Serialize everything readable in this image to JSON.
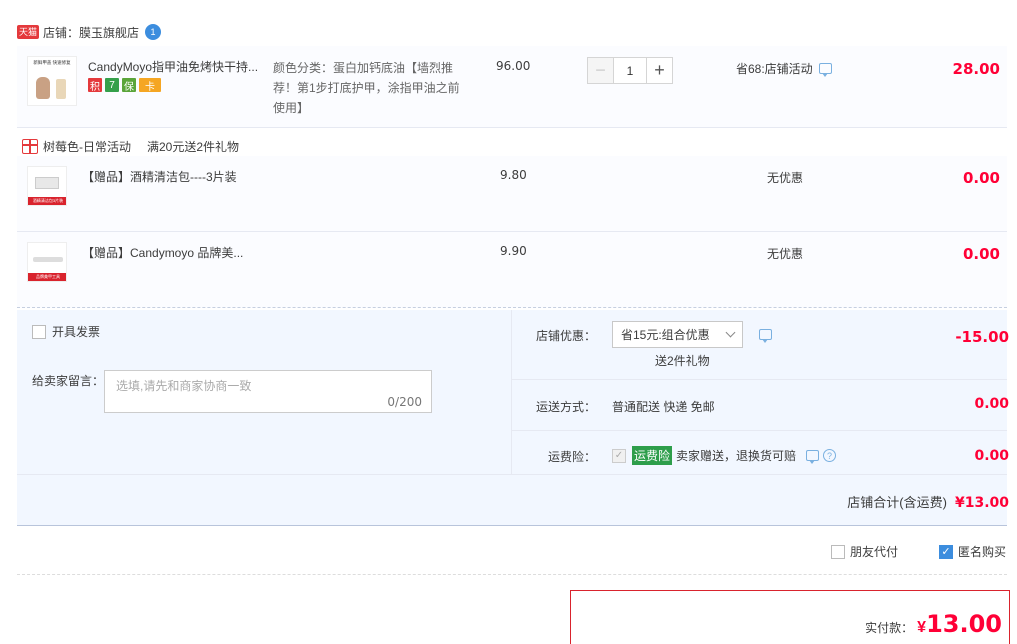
{
  "shop": {
    "label": "店铺：膜玉旗舰店",
    "tmall_badge": "天猫",
    "wangwang_icon": "chat-bubble-icon"
  },
  "main_item": {
    "title": "CandyMoyo指甲油免烤快干持...",
    "spec": "颜色分类：蛋白加钙底油【墙烈推荐！第1步打底护甲，涂指甲油之前使用】",
    "unit_price": "96.00",
    "quantity": "1",
    "discount": "省68:店铺活动",
    "subtotal": "28.00",
    "thumb_caption": "新鲜甲盖 快速修复",
    "badges": [
      "积",
      "7",
      "保",
      "卡"
    ]
  },
  "promo": {
    "label": "树莓色-日常活动",
    "detail": "满20元送2件礼物"
  },
  "gifts": [
    {
      "title": "【赠品】酒精清洁包----3片装",
      "price": "9.80",
      "discount": "无优惠",
      "subtotal": "0.00",
      "thumb_caption": "酒精清洁包3片装"
    },
    {
      "title": "【赠品】Candymoyo 品牌美...",
      "price": "9.90",
      "discount": "无优惠",
      "subtotal": "0.00",
      "thumb_caption": "品牌美甲工具"
    }
  ],
  "invoice": {
    "label": "开具发票"
  },
  "message": {
    "label": "给卖家留言：",
    "placeholder": "选填,请先和商家协商一致",
    "counter": "0/200"
  },
  "shop_discount": {
    "label": "店铺优惠：",
    "selected": "省15元:组合优惠",
    "note": "送2件礼物",
    "amount": "-15.00"
  },
  "shipping": {
    "label": "运送方式：",
    "value": "普通配送 快递 免邮",
    "amount": "0.00"
  },
  "insurance": {
    "label": "运费险：",
    "tag": "运费险",
    "value": "卖家赠送，退换货可赔",
    "amount": "0.00"
  },
  "shop_total": {
    "label": "店铺合计(含运费)",
    "amount": "¥13.00"
  },
  "options": {
    "friend_pay": "朋友代付",
    "anonymous": "匿名购买"
  },
  "pay": {
    "label": "实付款：",
    "amount": "13.00"
  },
  "colors": {
    "price_red": "#ff0036",
    "accent_blue": "#3c8dde",
    "panel_blue": "#f2f7ff",
    "tmall_red": "#e4393c",
    "insurance_green": "#4caf50"
  }
}
